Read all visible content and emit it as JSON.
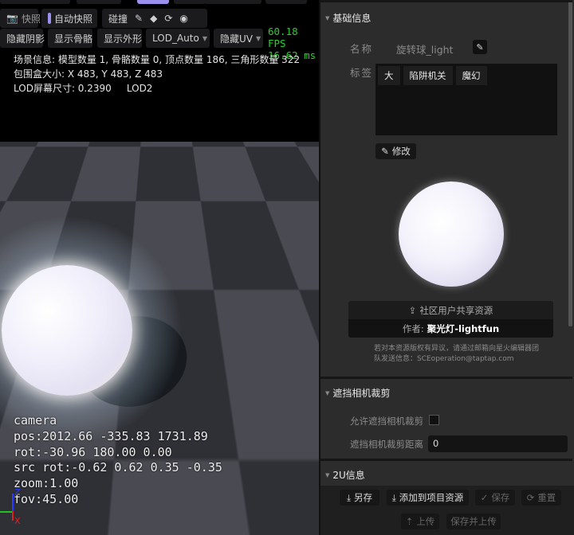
{
  "toolbar": {
    "snapshot": "快照",
    "auto_snapshot": "自动快照",
    "collision": "碰撞",
    "hide_shadow": "隐藏阴影",
    "show_skeleton": "显示骨骼",
    "show_shape": "显示外形",
    "lod_select": "LOD_Auto",
    "hide_uv": "隐藏UV"
  },
  "stats": {
    "fps": "60.18 FPS",
    "ms": "16.62 ms"
  },
  "scene_info": {
    "line1": "场景信息: 模型数量 1, 骨骼数量 0, 顶点数量 186, 三角形数量 322",
    "line2": "包围盒大小: X 483, Y 483, Z 483",
    "line3": "LOD屏幕尺寸: 0.2390     LOD2"
  },
  "camera": {
    "title": "camera",
    "pos": "pos:2012.66 -335.83 1731.89",
    "rot": "rot:-30.96 180.00 0.00",
    "src_rot": "src rot:-0.62 0.62 0.35 -0.35",
    "zoom": "zoom:1.00",
    "fov": "fov:45.00",
    "axis_z": "Z",
    "axis_x": "X"
  },
  "panel": {
    "basic": {
      "title": "基础信息",
      "name_label": "名称",
      "name_value": "旋转球_light",
      "tags_label": "标签",
      "tags": [
        "大",
        "陷阱机关",
        "魔幻"
      ],
      "edit_button": "修改"
    },
    "share": {
      "community": "社区用户共享资源",
      "author_label": "作者:",
      "author": "聚光灯-lightfun",
      "notice1": "若对本资源版权有异议，请通过邮箱向星火编辑器团",
      "notice2": "队发送信息：SCEoperation@taptap.com"
    },
    "occlusion": {
      "title": "遮挡相机裁剪",
      "allow_label": "允许遮挡相机裁剪",
      "distance_label": "遮挡相机裁剪距离",
      "distance_value": "0"
    },
    "info2u": {
      "title": "2U信息"
    },
    "actions": {
      "save_as": "另存",
      "add_to_project": "添加到项目资源",
      "save": "保存",
      "reset": "重置",
      "upload": "上传",
      "save_upload": "保存并上传"
    }
  }
}
